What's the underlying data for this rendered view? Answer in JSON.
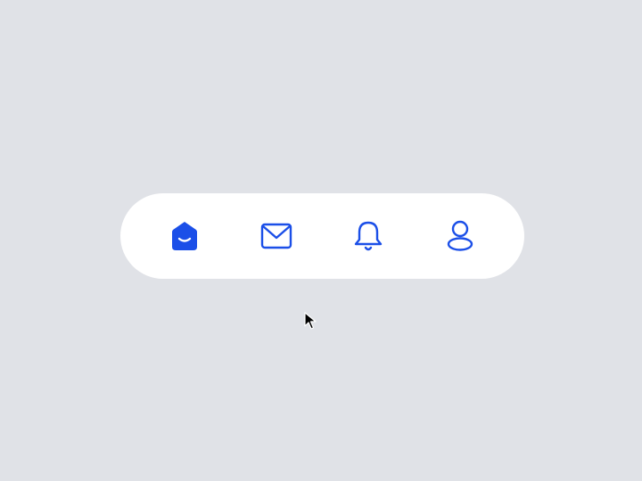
{
  "colors": {
    "background": "#e0e2e7",
    "bar": "#ffffff",
    "accent": "#1b4fe8"
  },
  "tabbar": {
    "active_index": 0,
    "items": [
      {
        "icon": "home-icon",
        "state": "active"
      },
      {
        "icon": "mail-icon",
        "state": "inactive"
      },
      {
        "icon": "bell-icon",
        "state": "inactive"
      },
      {
        "icon": "user-icon",
        "state": "inactive"
      }
    ]
  },
  "pointer": {
    "icon": "mouse-pointer-icon"
  }
}
